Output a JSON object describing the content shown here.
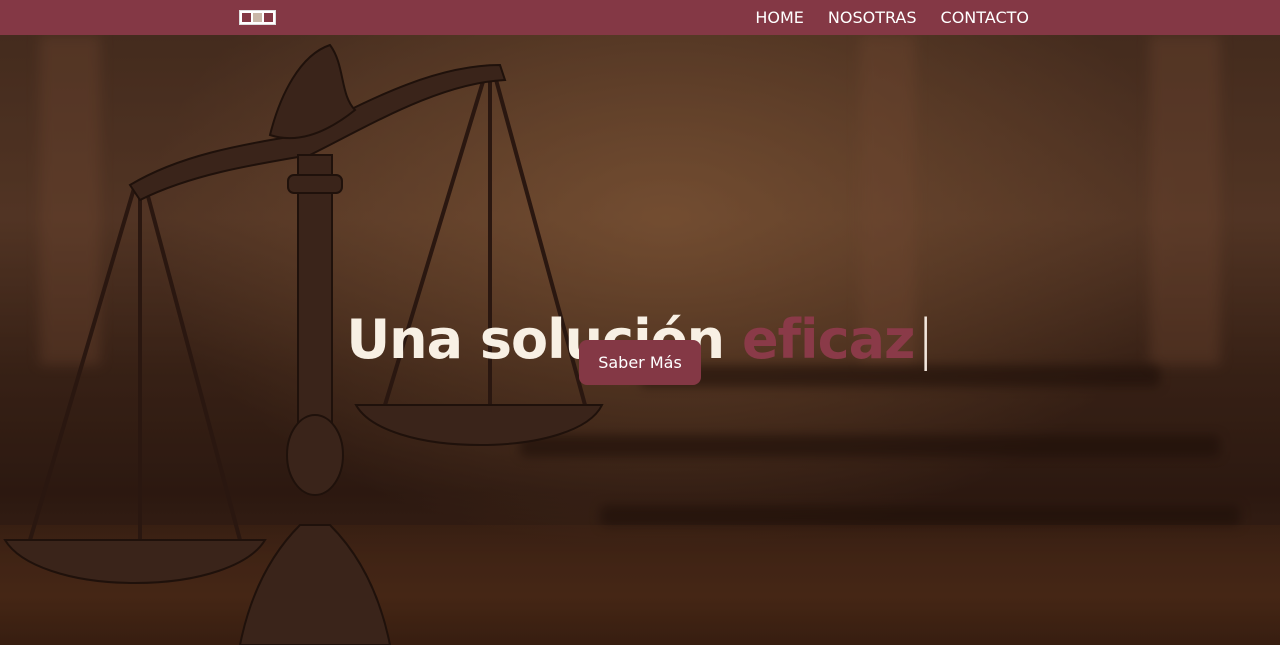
{
  "nav": {
    "logo_icon": "firm-logo-icon",
    "links": [
      "HOME",
      "NOSOTRAS",
      "CONTACTO"
    ]
  },
  "hero": {
    "headline_main": "Una solución",
    "headline_accent": "eficaz",
    "cursor": "|",
    "cta_label": "Saber Más",
    "background_icon": "scales-of-justice-icon"
  },
  "colors": {
    "brand": "#843845",
    "headline_text": "#f8f0e4"
  }
}
